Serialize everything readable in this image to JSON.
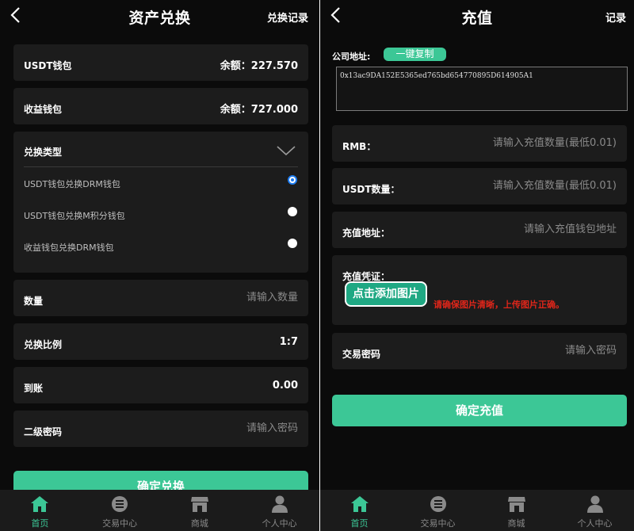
{
  "left": {
    "title": "资产兑换",
    "top_link": "兑换记录",
    "usdt_wallet": {
      "label": "USDT钱包",
      "balance_prefix": "余额：",
      "balance": "227.570"
    },
    "income_wallet": {
      "label": "收益钱包",
      "balance_prefix": "余额：",
      "balance": "727.000"
    },
    "exchange_type": {
      "label": "兑换类型",
      "options": [
        {
          "label": "USDT钱包兑换DRM钱包",
          "checked": true
        },
        {
          "label": "USDT钱包兑换M积分钱包",
          "checked": false
        },
        {
          "label": "收益钱包兑换DRM钱包",
          "checked": false
        }
      ]
    },
    "quantity": {
      "label": "数量",
      "placeholder": "请输入数量"
    },
    "ratio": {
      "label": "兑换比例",
      "value": "1:7"
    },
    "arrival": {
      "label": "到账",
      "value": "0.00"
    },
    "second_password": {
      "label": "二级密码",
      "placeholder": "请输入密码"
    },
    "confirm_button": "确定兑换"
  },
  "right": {
    "title": "充值",
    "top_link": "记录",
    "company_address": {
      "label": "公司地址:",
      "copy_button": "一键复制",
      "address": "0x13ac9DA152E5365ed765bd654770895D614905A1"
    },
    "rmb": {
      "label": "RMB：",
      "placeholder": "请输入充值数量(最低0.01)"
    },
    "usdt_amount": {
      "label": "USDT数量：",
      "placeholder": "请输入充值数量(最低0.01)"
    },
    "recharge_address": {
      "label": "充值地址：",
      "placeholder": "请输入充值钱包地址"
    },
    "voucher": {
      "label": "充值凭证：",
      "upload_button": "点击添加图片",
      "warning": "请确保图片清晰，上传图片正确。"
    },
    "trade_password": {
      "label": "交易密码",
      "placeholder": "请输入密码"
    },
    "confirm_button": "确定充值"
  },
  "tabbar": {
    "items": [
      {
        "label": "首页",
        "icon": "home-icon",
        "active": true
      },
      {
        "label": "交易中心",
        "icon": "list-icon",
        "active": false
      },
      {
        "label": "商城",
        "icon": "store-icon",
        "active": false
      },
      {
        "label": "个人中心",
        "icon": "user-icon",
        "active": false
      }
    ]
  },
  "colors": {
    "accent": "#3cc796",
    "background": "#0b0b0b",
    "card": "#1c1c1c",
    "warning": "#e0261a",
    "radio_checked": "#1e7cf0"
  }
}
